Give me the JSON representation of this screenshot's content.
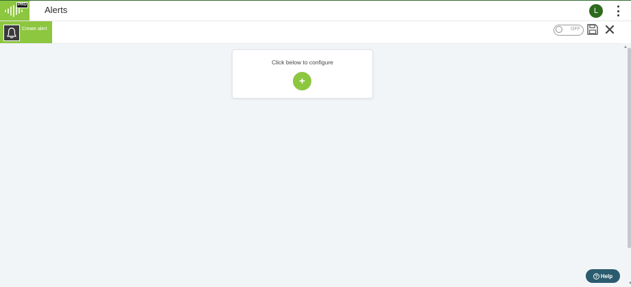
{
  "header": {
    "logo_badge": "PRO",
    "title": "Alerts",
    "avatar_initial": "L",
    "logo_icon": "waveform-icon",
    "menu_icon": "kebab-menu-icon"
  },
  "toolbar": {
    "create_label": "Create alert",
    "create_icon": "bell-icon",
    "toggle_label": "OFF",
    "save_icon": "floppy-disk-icon",
    "close_icon": "close-icon"
  },
  "main": {
    "configure_text": "Click below to configure",
    "add_label": "+"
  },
  "help": {
    "label": "Help",
    "icon_glyph": "?"
  },
  "colors": {
    "brand_green": "#8dc63f",
    "avatar_green": "#2f6b1f",
    "help_bg": "#2b5b6e",
    "background": "#f2f5f8"
  }
}
